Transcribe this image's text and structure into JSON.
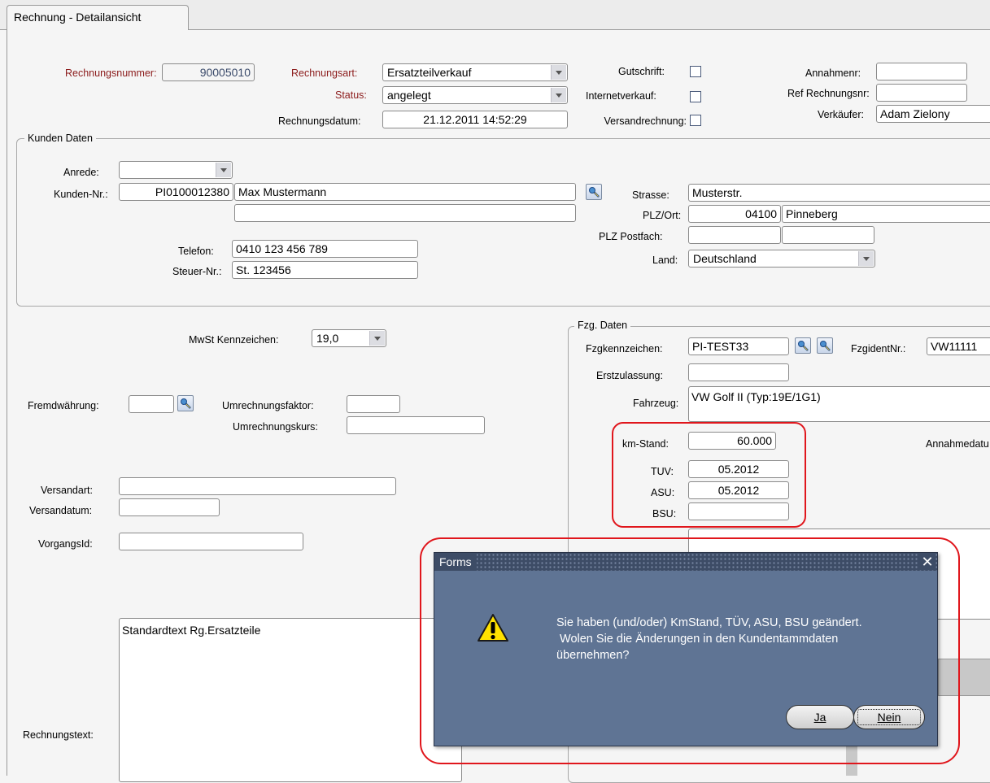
{
  "window": {
    "tab_title": "Rechnung - Detailansicht"
  },
  "header": {
    "rechnungsnummer_label": "Rechnungsnummer:",
    "rechnungsnummer_value": "90005010",
    "rechnungsart_label": "Rechnungsart:",
    "rechnungsart_value": "Ersatzteilverkauf",
    "status_label": "Status:",
    "status_value": "angelegt",
    "rechnungsdatum_label": "Rechnungsdatum:",
    "rechnungsdatum_value": "21.12.2011  14:52:29",
    "gutschrift_label": "Gutschrift:",
    "internetverkauf_label": "Internetverkauf:",
    "versandrechnung_label": "Versandrechnung:",
    "annahmenr_label": "Annahmenr:",
    "annahmenr_value": "",
    "ref_label": "Ref Rechnungsnr:",
    "ref_value": "",
    "verkaeufer_label": "Verkäufer:",
    "verkaeufer_value": "Adam Zielony"
  },
  "kunde": {
    "group_title": "Kunden Daten",
    "anrede_label": "Anrede:",
    "anrede_value": "",
    "kundennr_label": "Kunden-Nr.:",
    "kundennr_value": "PI0100012380",
    "name_value": "Max Mustermann",
    "name2_value": "",
    "telefon_label": "Telefon:",
    "telefon_value": "0410 123 456 789",
    "steuer_label": "Steuer-Nr.:",
    "steuer_value": "St. 123456",
    "strasse_label": "Strasse:",
    "strasse_value": "Musterstr.",
    "plzort_label": "PLZ/Ort:",
    "plz_value": "04100",
    "ort_value": "Pinneberg",
    "postfach_label": "PLZ Postfach:",
    "land_label": "Land:",
    "land_value": "Deutschland"
  },
  "left": {
    "mwst_label": "MwSt Kennzeichen:",
    "mwst_value": "19,0",
    "fremdw_label": "Fremdwährung:",
    "umfaktor_label": "Umrechnungsfaktor:",
    "umkurs_label": "Umrechnungskurs:",
    "versandart_label": "Versandart:",
    "versanddatum_label": "Versandatum:",
    "vorgang_label": "VorgangsId:",
    "rechnungstext_label": "Rechnungstext:",
    "rechnungstext_value": "Standardtext Rg.Ersatzteile"
  },
  "fzg": {
    "group_title": "Fzg. Daten",
    "kennz_label": "Fzgkennzeichen:",
    "kennz_value": "PI-TEST33",
    "ident_label": "FzgidentNr.:",
    "ident_value": "VW11111",
    "erstzul_label": "Erstzulassung:",
    "fahrzeug_label": "Fahrzeug:",
    "fahrzeug_value": "VW Golf II (Typ:19E/1G1)",
    "km_label": "km-Stand:",
    "km_value": "60.000",
    "annahmedatum_label": "Annahmedatu",
    "tuv_label": "TUV:",
    "tuv_value": "05.2012",
    "asu_label": "ASU:",
    "asu_value": "05.2012",
    "bsu_label": "BSU:",
    "bsu_value": ""
  },
  "dialog": {
    "title": "Forms",
    "close_glyph": "✕",
    "line1": "Sie haben (und/oder) KmStand, TÜV, ASU, BSU geändert.",
    "line2": " Wolen Sie die Änderungen in den Kundentammdaten",
    "line3": "übernehmen?",
    "yes_label": "Ja",
    "no_label": "Nein",
    "icon": "warning-icon"
  },
  "colors": {
    "required_label": "#8b1a1a",
    "dialog_bg": "#5f7494",
    "highlight": "#e0161c"
  }
}
